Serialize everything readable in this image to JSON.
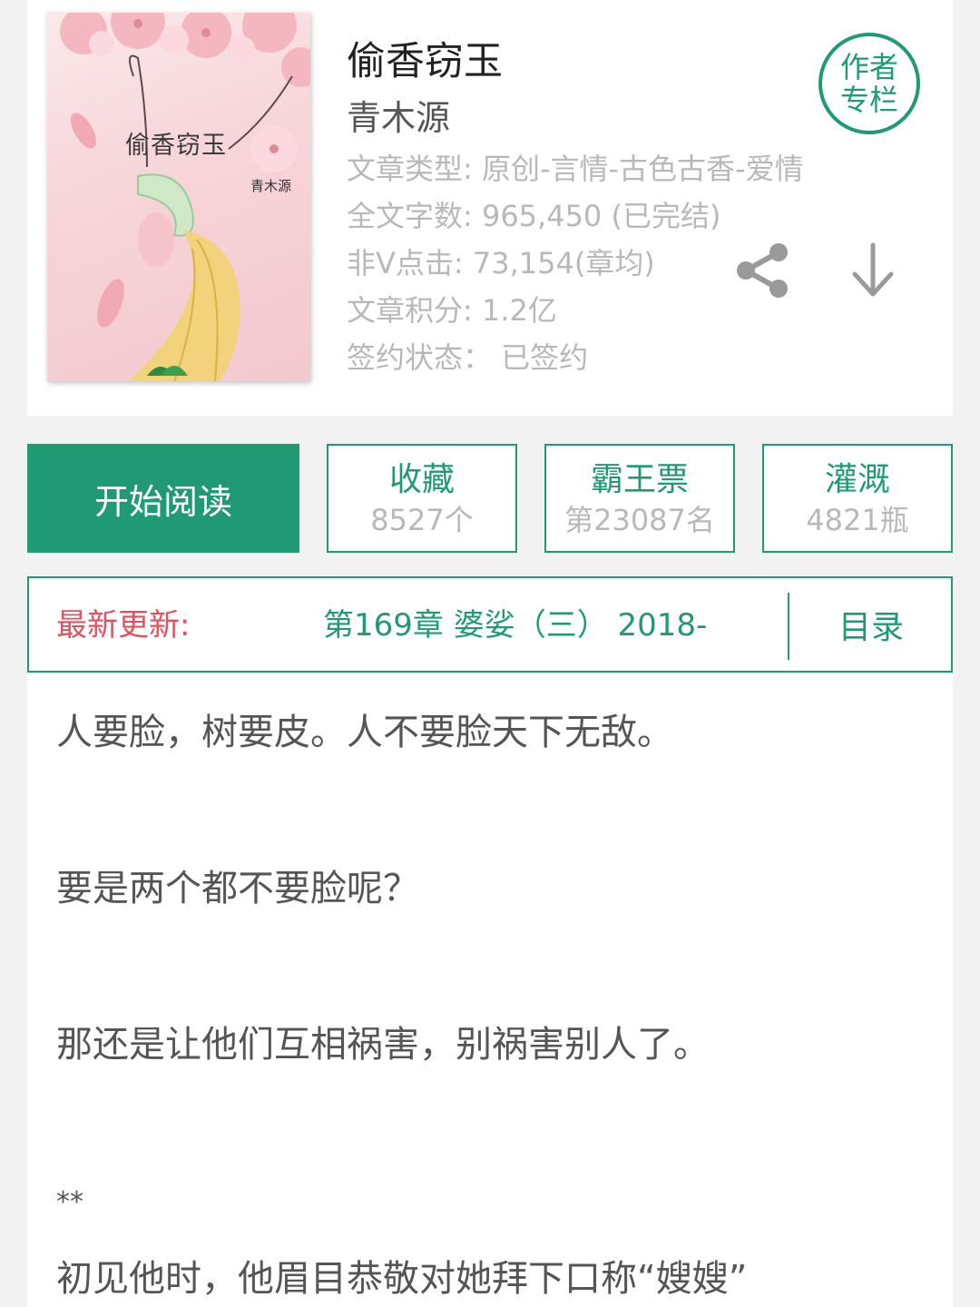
{
  "book": {
    "cover": {
      "title": "偷香窃玉",
      "author": "青木源"
    },
    "title": "偷香窃玉",
    "author": "青木源",
    "meta": {
      "type": "文章类型: 原创-言情-古色古香-爱情",
      "word_count": "全文字数: 965,450 (已完结)",
      "clicks": "非V点击: 73,154(章均)",
      "score": "文章积分: 1.2亿",
      "contract": "签约状态： 已签约"
    },
    "author_column_badge": "作者专栏",
    "icons": [
      "share-icon",
      "download-icon"
    ]
  },
  "actions": {
    "read_label": "开始阅读",
    "favorite": {
      "label": "收藏",
      "value": "8527个"
    },
    "overlord_ticket": {
      "label": "霸王票",
      "value": "第23087名"
    },
    "nutrient": {
      "label": "灌溉",
      "value": "4821瓶"
    }
  },
  "latest_update": {
    "label": "最新更新:",
    "chapter": "第169章  婆娑（三）  2018-",
    "toc_label": "目录"
  },
  "synopsis": {
    "lines": [
      "人要脸，树要皮。人不要脸天下无敌。",
      "要是两个都不要脸呢？",
      "那还是让他们互相祸害，别祸害别人了。",
      "**",
      "初见他时，他眉目恭敬对她拜下口称“嫂嫂”"
    ]
  },
  "colors": {
    "accent": "#1f9a73",
    "update_label": "#e0525f",
    "muted_text": "#b8b8b8",
    "body_text": "#555555"
  }
}
